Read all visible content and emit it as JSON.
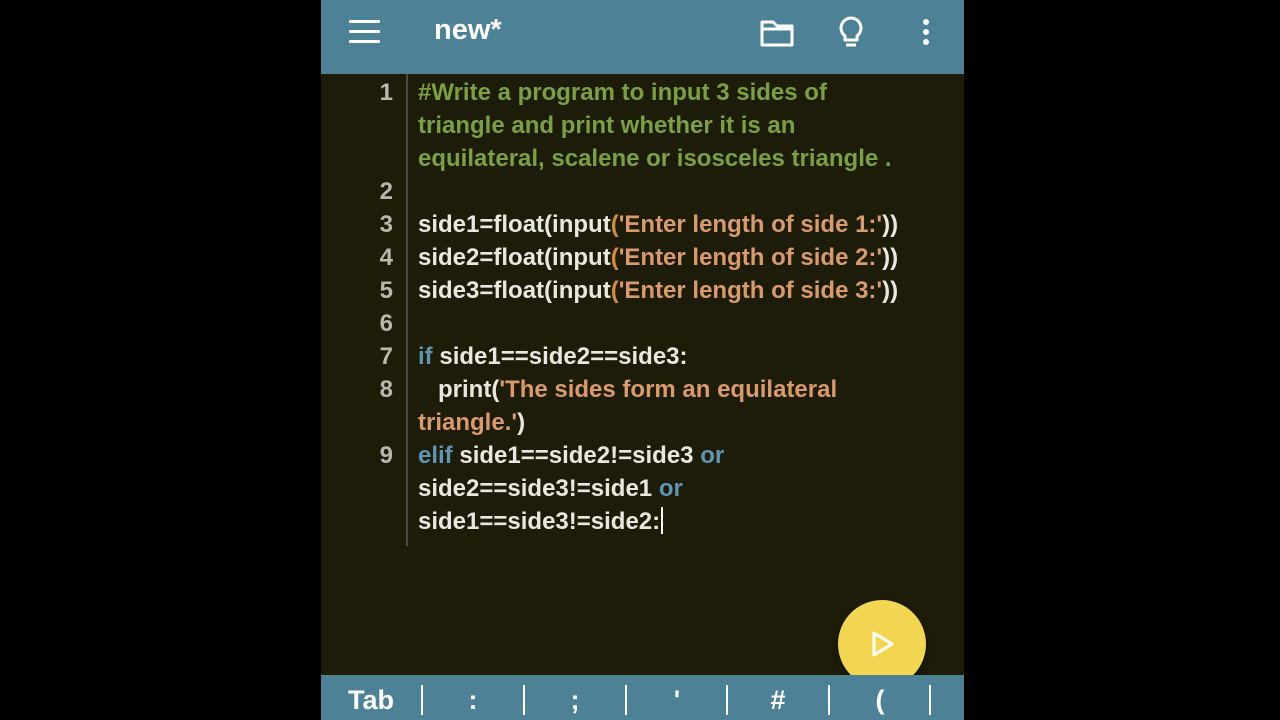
{
  "appbar": {
    "title": "new*",
    "icons": [
      "menu-icon",
      "folder-icon",
      "lightbulb-icon",
      "more-vert-icon"
    ]
  },
  "editor": {
    "line_numbers": [
      "1",
      "2",
      "3",
      "4",
      "5",
      "6",
      "7",
      "8",
      "9"
    ],
    "lines": [
      {
        "tokens": [
          {
            "t": "#Write a program to input 3 sides of",
            "k": "comment"
          }
        ]
      },
      {
        "tokens": [
          {
            "t": "triangle and print whether it is an",
            "k": "comment"
          }
        ]
      },
      {
        "tokens": [
          {
            "t": "equilateral, scalene or isosceles triangle .",
            "k": "comment"
          }
        ]
      },
      {
        "tokens": []
      },
      {
        "tokens": [
          {
            "t": "side1=float(input",
            "k": "def"
          },
          {
            "t": "(",
            "k": "paren"
          },
          {
            "t": "'Enter length of side 1:'",
            "k": "str"
          },
          {
            "t": "))",
            "k": "def"
          }
        ]
      },
      {
        "tokens": [
          {
            "t": "side2=float(input",
            "k": "def"
          },
          {
            "t": "(",
            "k": "paren"
          },
          {
            "t": "'Enter length of side 2:'",
            "k": "str"
          },
          {
            "t": "))",
            "k": "def"
          }
        ]
      },
      {
        "tokens": [
          {
            "t": "side3=float(input",
            "k": "def"
          },
          {
            "t": "(",
            "k": "paren"
          },
          {
            "t": "'Enter length of side 3:'",
            "k": "str"
          },
          {
            "t": "))",
            "k": "def"
          }
        ]
      },
      {
        "tokens": []
      },
      {
        "tokens": [
          {
            "t": "if",
            "k": "kw"
          },
          {
            "t": " side1==side2==side3:",
            "k": "def"
          }
        ]
      },
      {
        "tokens": [
          {
            "t": "   print(",
            "k": "def"
          },
          {
            "t": "'The sides form an equilateral",
            "k": "str"
          }
        ]
      },
      {
        "tokens": [
          {
            "t": "triangle.'",
            "k": "str"
          },
          {
            "t": ")",
            "k": "def"
          }
        ]
      },
      {
        "tokens": [
          {
            "t": "elif",
            "k": "kw"
          },
          {
            "t": " side1==side2!=side3 ",
            "k": "def"
          },
          {
            "t": "or",
            "k": "kw"
          }
        ]
      },
      {
        "tokens": [
          {
            "t": "side2==side3!=side1 ",
            "k": "def"
          },
          {
            "t": "or",
            "k": "kw"
          }
        ]
      },
      {
        "tokens": [
          {
            "t": "side1==side3!=side2:",
            "k": "def"
          }
        ],
        "cursor": true
      }
    ]
  },
  "fab": {
    "icon": "play-icon"
  },
  "keybar": {
    "keys": [
      "Tab",
      ":",
      ";",
      "'",
      "#",
      "("
    ]
  },
  "colors": {
    "appbar": "#4d8296",
    "editor_bg": "#1c1c08",
    "comment": "#7aa041",
    "keyword": "#5f95b2",
    "string": "#d99a6c",
    "fab": "#f2d652"
  }
}
